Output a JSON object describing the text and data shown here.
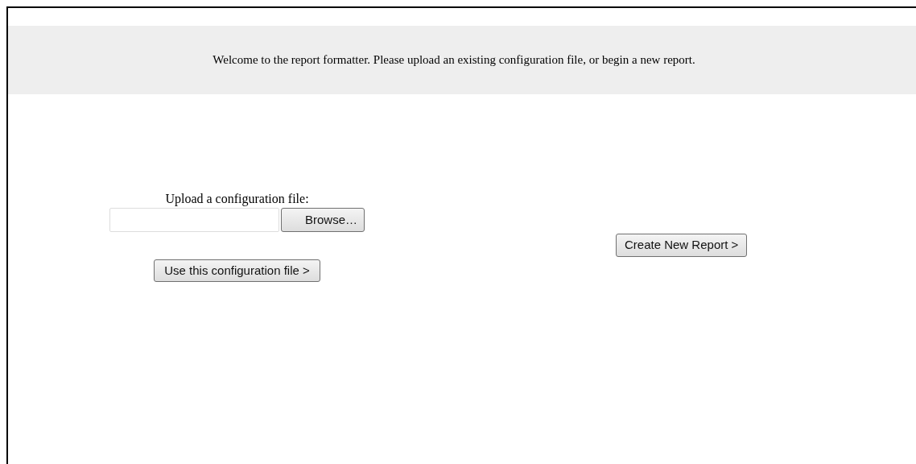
{
  "banner": {
    "text": "Welcome to the report formatter. Please upload an existing configuration file, or begin a new report."
  },
  "upload": {
    "label": "Upload a configuration file:",
    "browse_button": "Browse…",
    "submit_button": "Use this configuration file >"
  },
  "create_button": "Create New Report >"
}
